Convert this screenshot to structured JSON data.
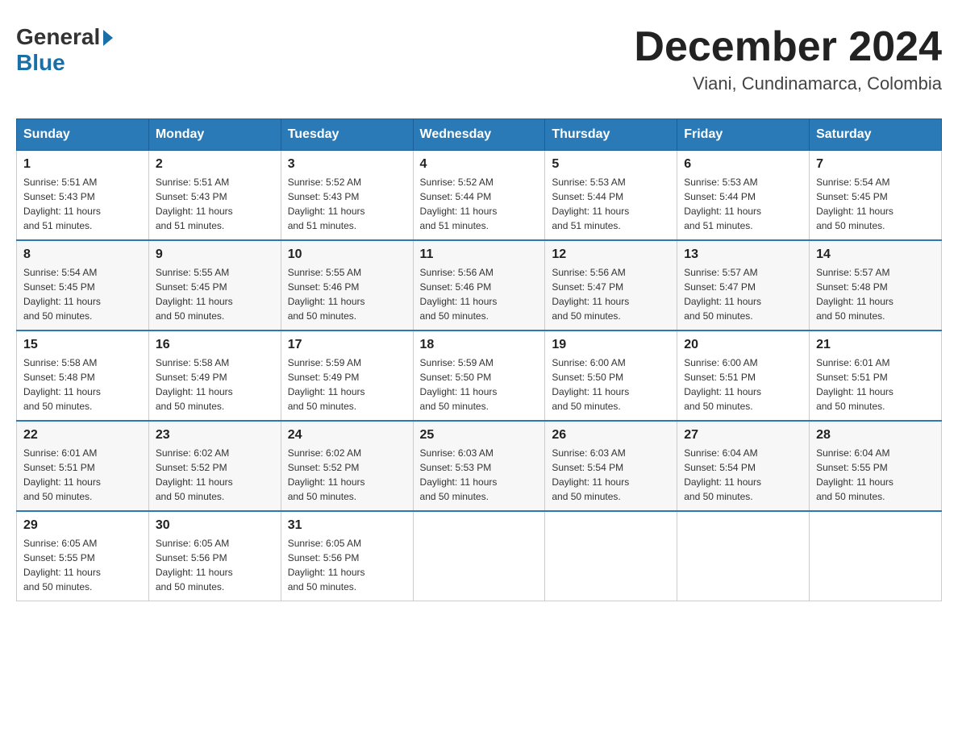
{
  "header": {
    "logo_general": "General",
    "logo_blue": "Blue",
    "month_title": "December 2024",
    "location": "Viani, Cundinamarca, Colombia"
  },
  "days_of_week": [
    "Sunday",
    "Monday",
    "Tuesday",
    "Wednesday",
    "Thursday",
    "Friday",
    "Saturday"
  ],
  "weeks": [
    [
      {
        "day": "1",
        "sunrise": "5:51 AM",
        "sunset": "5:43 PM",
        "daylight": "11 hours and 51 minutes."
      },
      {
        "day": "2",
        "sunrise": "5:51 AM",
        "sunset": "5:43 PM",
        "daylight": "11 hours and 51 minutes."
      },
      {
        "day": "3",
        "sunrise": "5:52 AM",
        "sunset": "5:43 PM",
        "daylight": "11 hours and 51 minutes."
      },
      {
        "day": "4",
        "sunrise": "5:52 AM",
        "sunset": "5:44 PM",
        "daylight": "11 hours and 51 minutes."
      },
      {
        "day": "5",
        "sunrise": "5:53 AM",
        "sunset": "5:44 PM",
        "daylight": "11 hours and 51 minutes."
      },
      {
        "day": "6",
        "sunrise": "5:53 AM",
        "sunset": "5:44 PM",
        "daylight": "11 hours and 51 minutes."
      },
      {
        "day": "7",
        "sunrise": "5:54 AM",
        "sunset": "5:45 PM",
        "daylight": "11 hours and 50 minutes."
      }
    ],
    [
      {
        "day": "8",
        "sunrise": "5:54 AM",
        "sunset": "5:45 PM",
        "daylight": "11 hours and 50 minutes."
      },
      {
        "day": "9",
        "sunrise": "5:55 AM",
        "sunset": "5:45 PM",
        "daylight": "11 hours and 50 minutes."
      },
      {
        "day": "10",
        "sunrise": "5:55 AM",
        "sunset": "5:46 PM",
        "daylight": "11 hours and 50 minutes."
      },
      {
        "day": "11",
        "sunrise": "5:56 AM",
        "sunset": "5:46 PM",
        "daylight": "11 hours and 50 minutes."
      },
      {
        "day": "12",
        "sunrise": "5:56 AM",
        "sunset": "5:47 PM",
        "daylight": "11 hours and 50 minutes."
      },
      {
        "day": "13",
        "sunrise": "5:57 AM",
        "sunset": "5:47 PM",
        "daylight": "11 hours and 50 minutes."
      },
      {
        "day": "14",
        "sunrise": "5:57 AM",
        "sunset": "5:48 PM",
        "daylight": "11 hours and 50 minutes."
      }
    ],
    [
      {
        "day": "15",
        "sunrise": "5:58 AM",
        "sunset": "5:48 PM",
        "daylight": "11 hours and 50 minutes."
      },
      {
        "day": "16",
        "sunrise": "5:58 AM",
        "sunset": "5:49 PM",
        "daylight": "11 hours and 50 minutes."
      },
      {
        "day": "17",
        "sunrise": "5:59 AM",
        "sunset": "5:49 PM",
        "daylight": "11 hours and 50 minutes."
      },
      {
        "day": "18",
        "sunrise": "5:59 AM",
        "sunset": "5:50 PM",
        "daylight": "11 hours and 50 minutes."
      },
      {
        "day": "19",
        "sunrise": "6:00 AM",
        "sunset": "5:50 PM",
        "daylight": "11 hours and 50 minutes."
      },
      {
        "day": "20",
        "sunrise": "6:00 AM",
        "sunset": "5:51 PM",
        "daylight": "11 hours and 50 minutes."
      },
      {
        "day": "21",
        "sunrise": "6:01 AM",
        "sunset": "5:51 PM",
        "daylight": "11 hours and 50 minutes."
      }
    ],
    [
      {
        "day": "22",
        "sunrise": "6:01 AM",
        "sunset": "5:51 PM",
        "daylight": "11 hours and 50 minutes."
      },
      {
        "day": "23",
        "sunrise": "6:02 AM",
        "sunset": "5:52 PM",
        "daylight": "11 hours and 50 minutes."
      },
      {
        "day": "24",
        "sunrise": "6:02 AM",
        "sunset": "5:52 PM",
        "daylight": "11 hours and 50 minutes."
      },
      {
        "day": "25",
        "sunrise": "6:03 AM",
        "sunset": "5:53 PM",
        "daylight": "11 hours and 50 minutes."
      },
      {
        "day": "26",
        "sunrise": "6:03 AM",
        "sunset": "5:54 PM",
        "daylight": "11 hours and 50 minutes."
      },
      {
        "day": "27",
        "sunrise": "6:04 AM",
        "sunset": "5:54 PM",
        "daylight": "11 hours and 50 minutes."
      },
      {
        "day": "28",
        "sunrise": "6:04 AM",
        "sunset": "5:55 PM",
        "daylight": "11 hours and 50 minutes."
      }
    ],
    [
      {
        "day": "29",
        "sunrise": "6:05 AM",
        "sunset": "5:55 PM",
        "daylight": "11 hours and 50 minutes."
      },
      {
        "day": "30",
        "sunrise": "6:05 AM",
        "sunset": "5:56 PM",
        "daylight": "11 hours and 50 minutes."
      },
      {
        "day": "31",
        "sunrise": "6:05 AM",
        "sunset": "5:56 PM",
        "daylight": "11 hours and 50 minutes."
      },
      null,
      null,
      null,
      null
    ]
  ],
  "labels": {
    "sunrise": "Sunrise:",
    "sunset": "Sunset:",
    "daylight": "Daylight:"
  }
}
